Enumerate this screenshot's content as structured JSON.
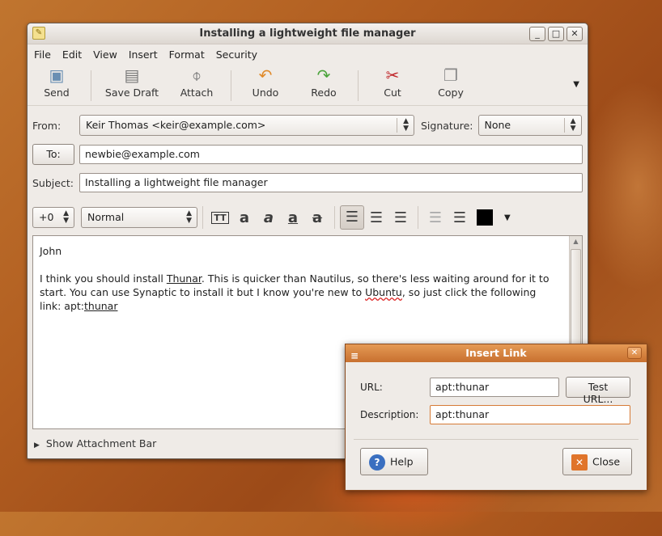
{
  "window": {
    "title": "Installing a lightweight file manager",
    "controls": {
      "minimize": "_",
      "maximize": "□",
      "close": "✕"
    }
  },
  "menu": [
    "File",
    "Edit",
    "View",
    "Insert",
    "Format",
    "Security"
  ],
  "toolbar": {
    "send": "Send",
    "save_draft": "Save Draft",
    "attach": "Attach",
    "undo": "Undo",
    "redo": "Redo",
    "cut": "Cut",
    "copy": "Copy"
  },
  "from": {
    "label": "From:",
    "value": "Keir Thomas <keir@example.com>",
    "signature_label": "Signature:",
    "signature_value": "None"
  },
  "to": {
    "button": "To:",
    "value": "newbie@example.com"
  },
  "subject": {
    "label": "Subject:",
    "value": "Installing a lightweight file manager"
  },
  "format": {
    "size": "+0",
    "style": "Normal"
  },
  "body": {
    "greeting": "John",
    "para_start": "I think you should install ",
    "word_thunar": "Thunar",
    "para_mid": ". This is quicker than Nautilus, so there's less waiting around for it to start. You can use Synaptic to install it but I know you're new to ",
    "word_ubuntu": "Ubuntu",
    "para_end": ", so just click the following link: apt:",
    "link_word": "thunar"
  },
  "attachment_bar": "Show Attachment Bar",
  "dialog": {
    "title": "Insert Link",
    "url_label": "URL:",
    "url_value": "apt:thunar",
    "test_button": "Test URL...",
    "description_label": "Description:",
    "description_value": "apt:thunar",
    "help": "Help",
    "close": "Close"
  },
  "colors": {
    "accent": "#d67a36",
    "desktop": "#b5652a",
    "text_color_swatch": "#000000"
  }
}
